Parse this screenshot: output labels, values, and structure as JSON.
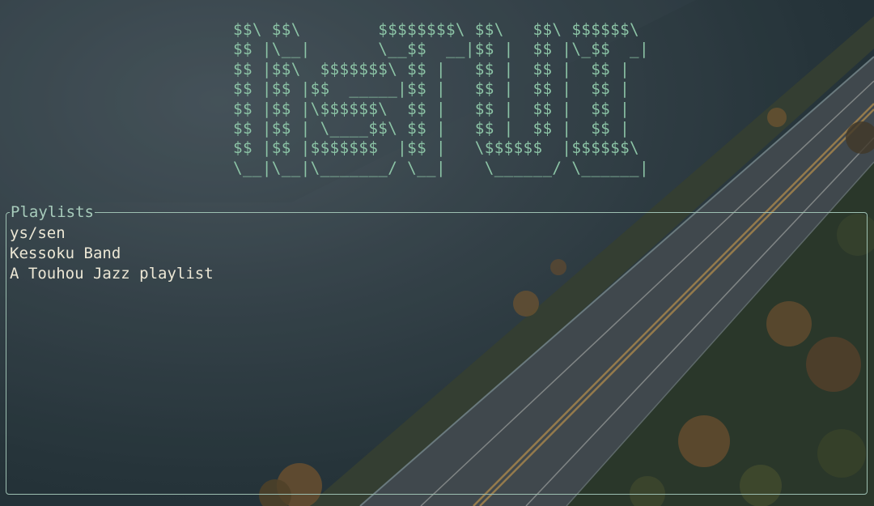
{
  "banner": {
    "lines": [
      "$$\\ $$\\        $$$$$$$$\\ $$\\   $$\\ $$$$$$\\",
      "$$ |\\__|       \\__$$  __|$$ |  $$ |\\_$$  _|",
      "$$ |$$\\  $$$$$$$\\ $$ |   $$ |  $$ |  $$ |",
      "$$ |$$ |$$  _____|$$ |   $$ |  $$ |  $$ |",
      "$$ |$$ |\\$$$$$$\\  $$ |   $$ |  $$ |  $$ |",
      "$$ |$$ | \\____$$\\ $$ |   $$ |  $$ |  $$ |",
      "$$ |$$ |$$$$$$$  |$$ |   \\$$$$$$  |$$$$$$\\",
      "\\__|\\__|\\_______/ \\__|    \\______/ \\______|"
    ]
  },
  "panel": {
    "title": "Playlists",
    "items": [
      "ys/sen",
      "Kessoku Band",
      "A Touhou Jazz playlist"
    ]
  },
  "colors": {
    "banner_text": "#8cc4a6",
    "panel_border": "#9dbfb1",
    "panel_title": "#a7cbbb",
    "item_text": "#ece7d5"
  }
}
